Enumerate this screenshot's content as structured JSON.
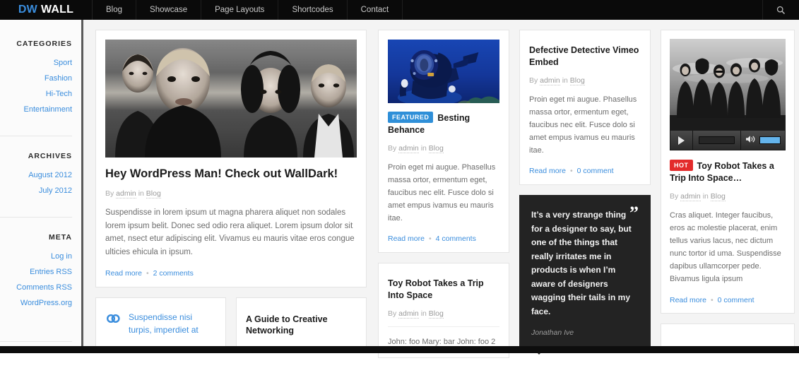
{
  "header": {
    "logo_prefix": "DW",
    "logo_suffix": "WALL",
    "nav": [
      {
        "label": "Blog"
      },
      {
        "label": "Showcase"
      },
      {
        "label": "Page Layouts"
      },
      {
        "label": "Shortcodes"
      },
      {
        "label": "Contact"
      }
    ],
    "search_icon": "search-icon"
  },
  "sidebar": {
    "widgets": [
      {
        "title": "CATEGORIES",
        "links": [
          "Sport",
          "Fashion",
          "Hi-Tech",
          "Entertainment"
        ]
      },
      {
        "title": "ARCHIVES",
        "links": [
          "August 2012",
          "July 2012"
        ]
      },
      {
        "title": "META",
        "links": [
          "Log in",
          "Entries RSS",
          "Comments RSS",
          "WordPress.org"
        ]
      }
    ]
  },
  "posts": {
    "featured_main": {
      "title": "Hey WordPress Man! Check out WallDark!",
      "meta_prefix": "By ",
      "meta_author": "admin",
      "meta_mid": " in ",
      "meta_category": "Blog",
      "excerpt": "Suspendisse in lorem ipsum ut magna pharera aliquet non sodales lorem ipsum belit. Donec sed odio rera aliquet. Lorem ipsum dolor sit amet, nsect etur adipiscing elit. Vivamus eu mauris vitae eros congue ulticies ehicula in ipsum.",
      "read_more": "Read more",
      "comments": "2 comments",
      "image_alt": "band-photo"
    },
    "link_post": {
      "icon": "link-icon",
      "text": "Suspendisse nisi turpis, imperdiet at"
    },
    "guide_post": {
      "title": "A Guide to Creative Networking"
    },
    "behance": {
      "badge": "FEATURED",
      "title": "Besting Behance",
      "meta_prefix": "By ",
      "meta_author": "admin",
      "meta_mid": " in ",
      "meta_category": "Blog",
      "excerpt": "Proin eget mi augue. Phasellus massa ortor, ermentum eget, faucibus nec elit. Fusce dolo si amet empus ivamus eu mauris itae.",
      "read_more": "Read more",
      "comments": "4 comments",
      "image_alt": "scuba-diver-photo"
    },
    "toy_robot_small": {
      "title": "Toy Robot Takes a Trip Into Space",
      "meta_prefix": "By ",
      "meta_author": "admin",
      "meta_mid": " in ",
      "meta_category": "Blog",
      "excerpt": "John: foo Mary: bar John: foo 2"
    },
    "vimeo": {
      "title": "Defective Detective Vimeo Embed",
      "meta_prefix": "By ",
      "meta_author": "admin",
      "meta_mid": " in ",
      "meta_category": "Blog",
      "excerpt": "Proin eget mi augue. Phasellus massa ortor, ermentum eget, faucibus nec elit. Fusce dolo si amet empus ivamus eu mauris itae.",
      "read_more": "Read more",
      "comments": "0 comment"
    },
    "quote": {
      "mark": "”",
      "text": "It’s a very strange thing for a designer to say, but one of the things that really irritates me in products is when I’m aware of designers wagging their tails in my face.",
      "author": "Jonathan Ive"
    },
    "audio_post": {
      "badge": "HOT",
      "title": "Toy Robot Takes a Trip Into Space…",
      "meta_prefix": "By ",
      "meta_author": "admin",
      "meta_mid": " in ",
      "meta_category": "Blog",
      "excerpt": "Cras aliquet. Integer faucibus, eros ac molestie placerat, enim tellus varius lacus, nec dictum nunc tortor id uma. Suspendisse dapibus ullamcorper pede. Bivamus ligula ipsum",
      "read_more": "Read more",
      "comments": "0 comment",
      "image_alt": "band-group-photo",
      "player": {
        "play_icon": "play-icon",
        "volume_icon": "volume-icon"
      }
    }
  },
  "colors": {
    "accent": "#3a8ddd",
    "featured_badge": "#2f8fd8",
    "hot_badge": "#e32b2b",
    "header_bg": "#0a0a0a",
    "page_bg": "#f4f4f4",
    "quote_bg": "#232323"
  }
}
